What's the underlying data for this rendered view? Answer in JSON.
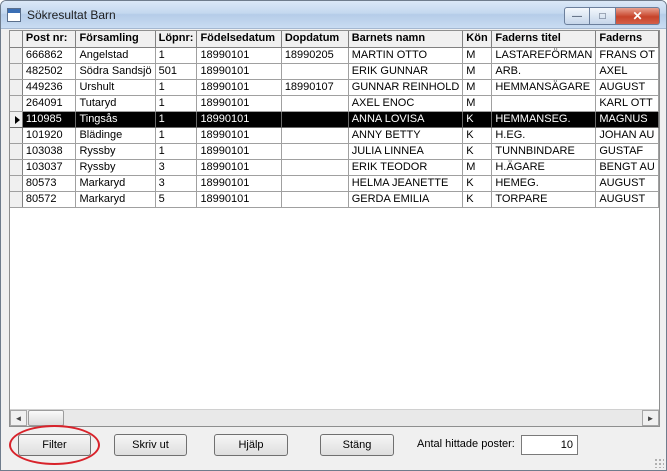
{
  "window": {
    "title": "Sökresultat Barn",
    "controls": {
      "minimize": "—",
      "maximize": "□",
      "close": "✕"
    }
  },
  "grid": {
    "columns": [
      "Post nr:",
      "Församling",
      "Löpnr:",
      "Födelsedatum",
      "Dopdatum",
      "Barnets namn",
      "Kön",
      "Faderns titel",
      "Faderns"
    ],
    "selected_row": 4,
    "rows": [
      [
        "666862",
        "Angelstad",
        "1",
        "18990101",
        "18990205",
        "MARTIN OTTO",
        "M",
        "LASTAREFÖRMAN",
        "FRANS OT"
      ],
      [
        "482502",
        "Södra Sandsjö",
        "501",
        "18990101",
        "",
        "ERIK GUNNAR",
        "M",
        "ARB.",
        "AXEL"
      ],
      [
        "449236",
        "Urshult",
        "1",
        "18990101",
        "18990107",
        "GUNNAR REINHOLD",
        "M",
        "HEMMANSÄGARE",
        "AUGUST"
      ],
      [
        "264091",
        "Tutaryd",
        "1",
        "18990101",
        "",
        "AXEL ENOC",
        "M",
        "",
        "KARL OTT"
      ],
      [
        "110985",
        "Tingsås",
        "1",
        "18990101",
        "",
        "ANNA LOVISA",
        "K",
        "HEMMANSEG.",
        "MAGNUS"
      ],
      [
        "101920",
        "Blädinge",
        "1",
        "18990101",
        "",
        "ANNY BETTY",
        "K",
        "H.EG.",
        "JOHAN AU"
      ],
      [
        "103038",
        "Ryssby",
        "1",
        "18990101",
        "",
        "JULIA LINNEA",
        "K",
        "TUNNBINDARE",
        "GUSTAF"
      ],
      [
        "103037",
        "Ryssby",
        "3",
        "18990101",
        "",
        "ERIK TEODOR",
        "M",
        "H.ÄGARE",
        "BENGT AU"
      ],
      [
        "80573",
        "Markaryd",
        "3",
        "18990101",
        "",
        "HELMA JEANETTE",
        "K",
        "HEMEG.",
        "AUGUST"
      ],
      [
        "80572",
        "Markaryd",
        "5",
        "18990101",
        "",
        "GERDA EMILIA",
        "K",
        "TORPARE",
        "AUGUST"
      ]
    ]
  },
  "scrollbar": {
    "left": "◄",
    "right": "►"
  },
  "buttons": {
    "filter": "Filter",
    "print": "Skriv ut",
    "help": "Hjälp",
    "close": "Stäng"
  },
  "found": {
    "label": "Antal hittade poster:",
    "value": "10"
  },
  "colors": {
    "annotation_circle": "#d8222a",
    "selected_row_bg": "#000000",
    "selected_row_fg": "#ffffff"
  }
}
